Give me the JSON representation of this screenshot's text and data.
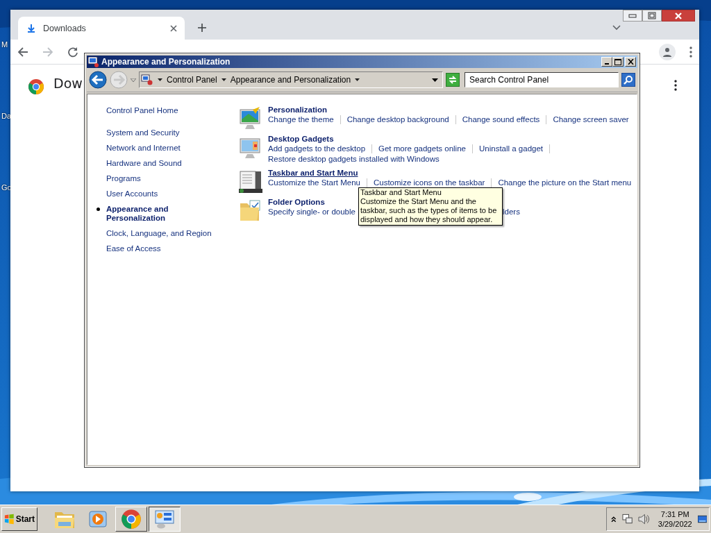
{
  "desktop": {
    "icon_labels": [
      "M",
      "Da",
      "Go"
    ]
  },
  "browser": {
    "tabs": [
      {
        "title": "Downloads",
        "selected": true
      }
    ],
    "page_heading": "Dow"
  },
  "control_panel": {
    "title": "Appearance and Personalization",
    "breadcrumbs": [
      "Control Panel",
      "Appearance and Personalization"
    ],
    "search": {
      "placeholder": "Search Control Panel"
    },
    "nav": [
      {
        "label": "Control Panel Home",
        "selected": false
      },
      {
        "label": "System and Security",
        "selected": false
      },
      {
        "label": "Network and Internet",
        "selected": false
      },
      {
        "label": "Hardware and Sound",
        "selected": false
      },
      {
        "label": "Programs",
        "selected": false
      },
      {
        "label": "User Accounts",
        "selected": false
      },
      {
        "label": "Appearance and Personalization",
        "selected": true
      },
      {
        "label": "Clock, Language, and Region",
        "selected": false
      },
      {
        "label": "Ease of Access",
        "selected": false
      }
    ],
    "categories": [
      {
        "kind": "personalization",
        "title": "Personalization",
        "hovered": false,
        "link_lines": [
          [
            "Change the theme",
            "Change desktop background",
            "Change sound effects",
            "Change screen saver"
          ]
        ]
      },
      {
        "kind": "gadgets",
        "title": "Desktop Gadgets",
        "hovered": false,
        "link_lines": [
          [
            "Add gadgets to the desktop",
            "Get more gadgets online",
            "Uninstall a gadget"
          ],
          [
            "Restore desktop gadgets installed with Windows"
          ]
        ]
      },
      {
        "kind": "taskbar",
        "title": "Taskbar and Start Menu",
        "hovered": true,
        "link_lines": [
          [
            "Customize the Start Menu",
            "Customize icons on the taskbar",
            "Change the picture on the Start menu"
          ]
        ]
      },
      {
        "kind": "folder",
        "title": "Folder Options",
        "hovered": false,
        "link_lines": [
          [
            "Specify single- or double",
            "lders"
          ]
        ]
      }
    ],
    "tooltip": {
      "title": "Taskbar and Start Menu",
      "text": "Customize the Start Menu and the taskbar, such as the types of items to be displayed and how they should appear."
    }
  },
  "taskbar": {
    "start": "Start",
    "apps": [
      {
        "kind": "folder",
        "running": false,
        "selected": false
      },
      {
        "kind": "media",
        "running": false,
        "selected": false
      },
      {
        "kind": "chrome",
        "running": true,
        "selected": false
      },
      {
        "kind": "control-panel",
        "running": true,
        "selected": true
      }
    ],
    "clock": {
      "time": "7:31 PM",
      "date": "3/29/2022"
    }
  }
}
